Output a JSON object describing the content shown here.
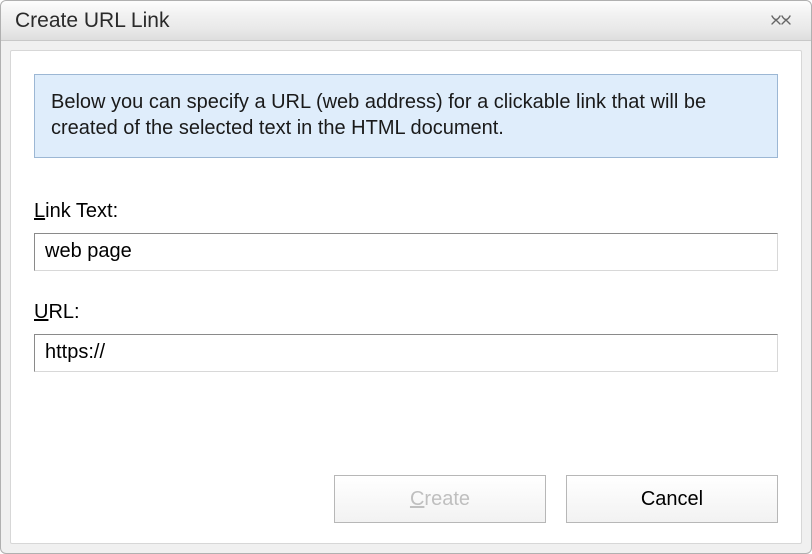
{
  "window": {
    "title": "Create URL Link"
  },
  "info": {
    "text": "Below you can specify a URL (web address) for a clickable link that will be created of the selected text in the HTML document."
  },
  "fields": {
    "linkText": {
      "label_accel": "L",
      "label_rest": "ink Text:",
      "value": "web page"
    },
    "url": {
      "label_accel": "U",
      "label_rest": "RL:",
      "value": "https://"
    }
  },
  "buttons": {
    "create_accel": "C",
    "create_rest": "reate",
    "cancel": "Cancel"
  }
}
